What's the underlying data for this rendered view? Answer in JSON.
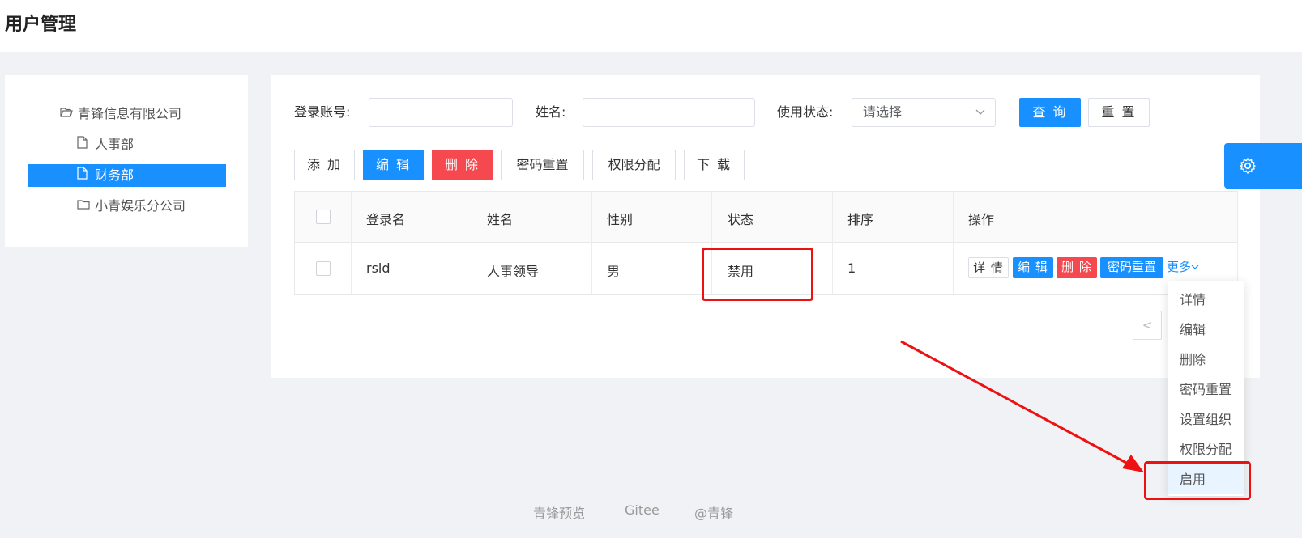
{
  "page_title": "用户管理",
  "tree": {
    "root": "青锋信息有限公司",
    "children": [
      "人事部",
      "财务部",
      "小青娱乐分公司"
    ],
    "selected": "财务部"
  },
  "search": {
    "account_label": "登录账号:",
    "account_value": "",
    "name_label": "姓名:",
    "name_value": "",
    "status_label": "使用状态:",
    "status_placeholder": "请选择",
    "query_label": "查 询",
    "reset_label": "重 置"
  },
  "toolbar": {
    "add": "添 加",
    "edit": "编 辑",
    "delete": "删 除",
    "reset_password": "密码重置",
    "permission": "权限分配",
    "download": "下 载"
  },
  "table": {
    "columns": [
      "登录名",
      "姓名",
      "性别",
      "状态",
      "排序",
      "操作"
    ],
    "rows": [
      {
        "login": "rsld",
        "name": "人事领导",
        "gender": "男",
        "status": "禁用",
        "sort": "1"
      }
    ],
    "row_actions": {
      "detail": "详 情",
      "edit": "编 辑",
      "delete": "删 除",
      "reset_password": "密码重置",
      "more": "更多"
    }
  },
  "more_menu": [
    "详情",
    "编辑",
    "删除",
    "密码重置",
    "设置组织",
    "权限分配",
    "启用"
  ],
  "more_menu_highlight": "启用",
  "pagination": {
    "prev": "<"
  },
  "footer": [
    "青锋预览",
    "Gitee",
    "@青锋"
  ],
  "colors": {
    "primary": "#1890ff",
    "danger": "#f5484f",
    "annotation": "#ee1111"
  },
  "icons": [
    "folder-open-icon",
    "file-icon",
    "folder-icon",
    "chevron-down-icon",
    "gear-icon",
    "arrow-annotation"
  ]
}
